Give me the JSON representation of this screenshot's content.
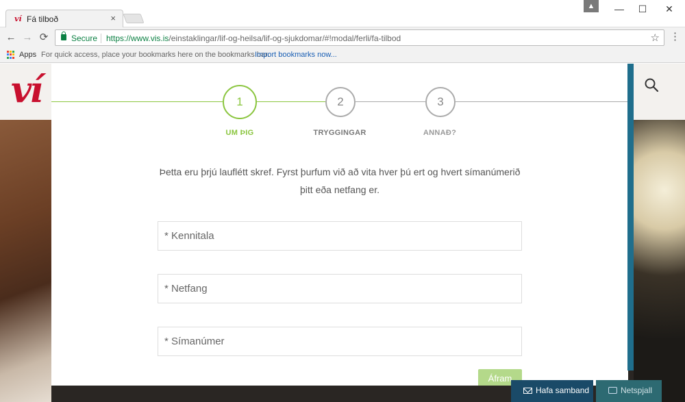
{
  "browser": {
    "tab_title": "Fá tilboð",
    "tab_favicon": "ví",
    "tab_close": "×",
    "profile_icon": "▲",
    "window_controls": {
      "minimize": "—",
      "maximize": "☐",
      "close": "✕"
    },
    "nav": {
      "back": "←",
      "forward": "→",
      "reload": "⟳"
    },
    "secure_label": "Secure",
    "url_host": "https://www.vis.is",
    "url_path": "/einstaklingar/lif-og-heilsa/lif-og-sjukdomar/#!modal/ferli/fa-tilbod",
    "star_icon": "☆",
    "menu_icon": "⋮"
  },
  "bookmarks": {
    "apps_label": "Apps",
    "hint": "For quick access, place your bookmarks here on the bookmarks bar.",
    "import_link": "Import bookmarks now..."
  },
  "site": {
    "logo_text": "ví",
    "brand_color": "#c8102e"
  },
  "steps": [
    {
      "number": "1",
      "label": "UM ÞIG",
      "state": "active"
    },
    {
      "number": "2",
      "label": "TRYGGINGAR",
      "state": "inactive"
    },
    {
      "number": "3",
      "label": "ANNAÐ?",
      "state": "inactive"
    }
  ],
  "form": {
    "intro": "Þetta eru þrjú lauflétt skref. Fyrst þurfum við að vita hver þú ert og hvert símanúmerið þitt eða netfang er.",
    "fields": [
      {
        "placeholder": "* Kennitala",
        "value": ""
      },
      {
        "placeholder": "* Netfang",
        "value": ""
      },
      {
        "placeholder": "* Símanúmer",
        "value": ""
      }
    ],
    "next_label": "Áfram"
  },
  "contact": {
    "call_label": "Hafa samband",
    "chat_label": "Netspjall"
  },
  "colors": {
    "accent_green": "#8ac53e",
    "secure_green": "#0b8043",
    "scroll_blue": "#1f6e8c",
    "contact_blue": "#1a4a68",
    "chat_teal": "#2d6a72"
  }
}
